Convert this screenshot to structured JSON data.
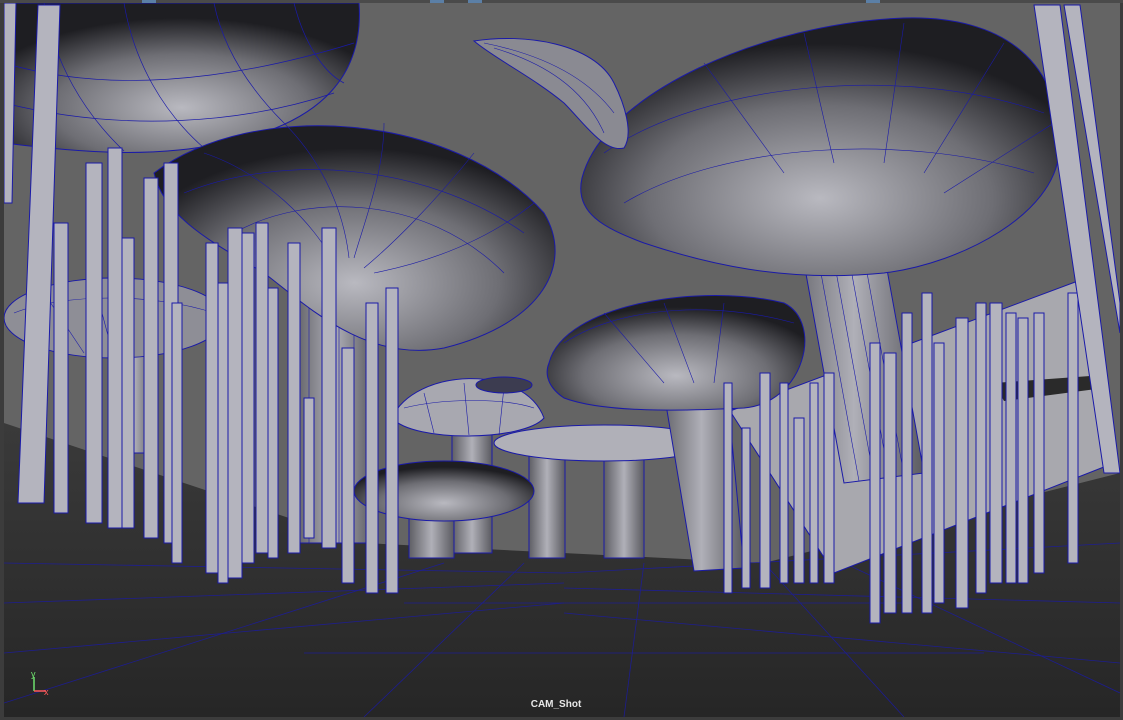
{
  "viewport": {
    "camera_name": "CAM_Shot",
    "axis": {
      "y_label": "y",
      "x_label": "x"
    }
  },
  "colors": {
    "background": "#646464",
    "ground": "#2e2e2e",
    "wireframe": "#1a1aa8",
    "shaded_light": "#a9a9b4",
    "shaded_dark": "#1a1a1a"
  }
}
